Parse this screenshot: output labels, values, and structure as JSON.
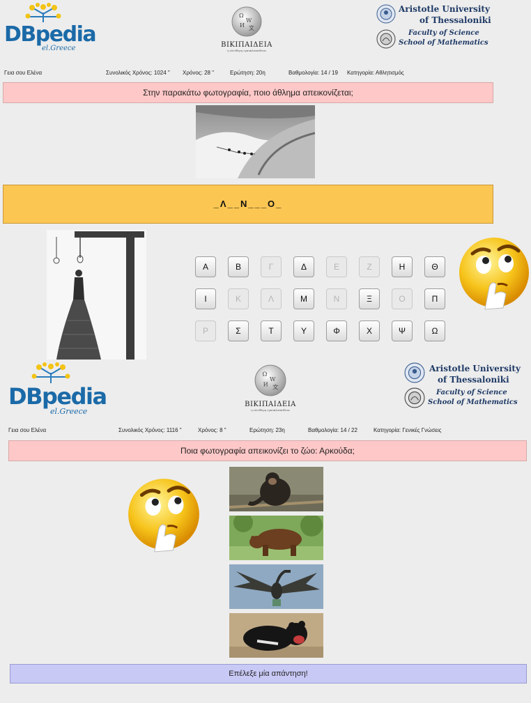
{
  "header": {
    "dbpedia_word": "DBpedia",
    "dbpedia_sub": "el.Greece",
    "wikipedia_name": "BIKIΠAIΔEIA",
    "wikipedia_slogan": "η ελεύθερη εγκυκλοπαίδεια",
    "university_line1": "Aristotle University",
    "university_line2": "of Thessaloniki",
    "faculty_line1": "Faculty of Science",
    "faculty_line2": "School of Mathematics"
  },
  "screen1": {
    "greeting": "Γεια σου Ελένα",
    "total_time": "Συνολικός Χρόνος:  1024 \"",
    "time": "Χρόνος:  28 \"",
    "question_no": "Ερώτηση: 20η",
    "score": "Βαθμολογία: 14 / 19",
    "category": "Κατηγορία: Αθλητισμός",
    "question": "Στην παρακάτω φωτογραφία, ποιο άθλημα απεικονίζεται;",
    "hidden_word": "_Λ__Ν___Ο_",
    "keyboard": [
      [
        {
          "l": "Α",
          "on": true
        },
        {
          "l": "Β",
          "on": true
        },
        {
          "l": "Γ",
          "on": false
        },
        {
          "l": "Δ",
          "on": true
        },
        {
          "l": "Ε",
          "on": false
        },
        {
          "l": "Ζ",
          "on": false
        },
        {
          "l": "Η",
          "on": true
        },
        {
          "l": "Θ",
          "on": true
        }
      ],
      [
        {
          "l": "Ι",
          "on": true
        },
        {
          "l": "Κ",
          "on": false
        },
        {
          "l": "Λ",
          "on": false
        },
        {
          "l": "Μ",
          "on": true
        },
        {
          "l": "Ν",
          "on": false
        },
        {
          "l": "Ξ",
          "on": true
        },
        {
          "l": "Ο",
          "on": false
        },
        {
          "l": "Π",
          "on": true
        }
      ],
      [
        {
          "l": "Ρ",
          "on": false
        },
        {
          "l": "Σ",
          "on": true
        },
        {
          "l": "Τ",
          "on": true
        },
        {
          "l": "Υ",
          "on": true
        },
        {
          "l": "Φ",
          "on": true
        },
        {
          "l": "Χ",
          "on": true
        },
        {
          "l": "Ψ",
          "on": true
        },
        {
          "l": "Ω",
          "on": true
        }
      ]
    ]
  },
  "screen2": {
    "greeting": "Γεια σου Ελένα",
    "total_time": "Συνολικός Χρόνος:  1116 \"",
    "time": "Χρόνος:  8 \"",
    "question_no": "Ερώτηση: 23η",
    "score": "Βαθμολογία: 14 / 22",
    "category": "Κατηγορία: Γενικές Γνώσεις",
    "question": "Ποια φωτογραφία απεικονίζει το ζώο: Αρκούδα;",
    "answer_prompt": "Επέλεξε μία απάντηση!",
    "options": [
      "chimpanzee-photo",
      "bear-photo",
      "cormorant-photo",
      "tasmanian-devil-photo"
    ]
  },
  "colors": {
    "question_bg": "#ffc8c8",
    "word_bg": "#fbc652",
    "answer_bg": "#c9c9f6",
    "brand_blue": "#1b6aa8",
    "panel_bg": "#ededed"
  }
}
